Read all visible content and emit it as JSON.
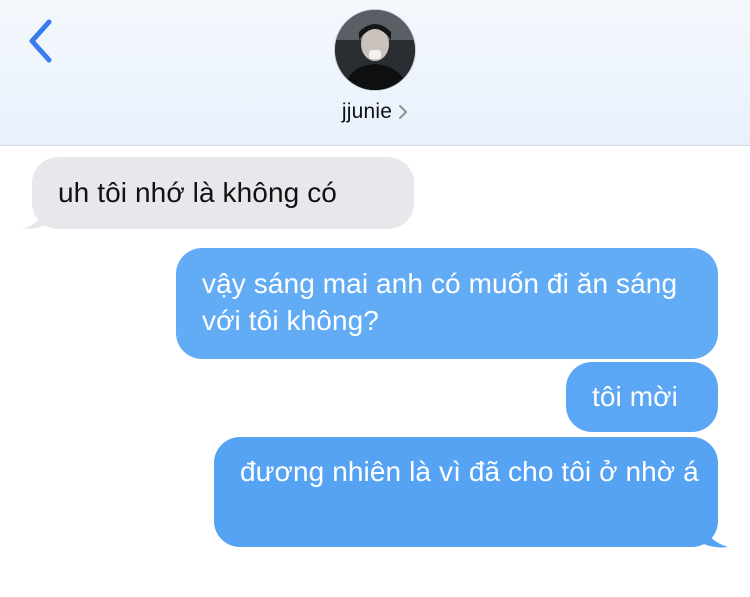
{
  "header": {
    "back_icon": "chevron-left-icon",
    "contact_name": "jjunie",
    "contact_chevron_icon": "chevron-right-icon",
    "accent_color": "#3a7cf0"
  },
  "messages": [
    {
      "direction": "incoming",
      "text": "uh tôi nhớ là không có"
    },
    {
      "direction": "outgoing",
      "text": "vậy sáng mai anh có muốn đi ăn sáng với tôi không?"
    },
    {
      "direction": "outgoing",
      "text": "tôi mời"
    },
    {
      "direction": "outgoing",
      "text": "đương nhiên là vì đã cho tôi ở nhờ á"
    }
  ],
  "colors": {
    "incoming_bubble": "#e8e8ec",
    "outgoing_bubble": "#5da9f6",
    "header_bg": "#edf3fb"
  }
}
